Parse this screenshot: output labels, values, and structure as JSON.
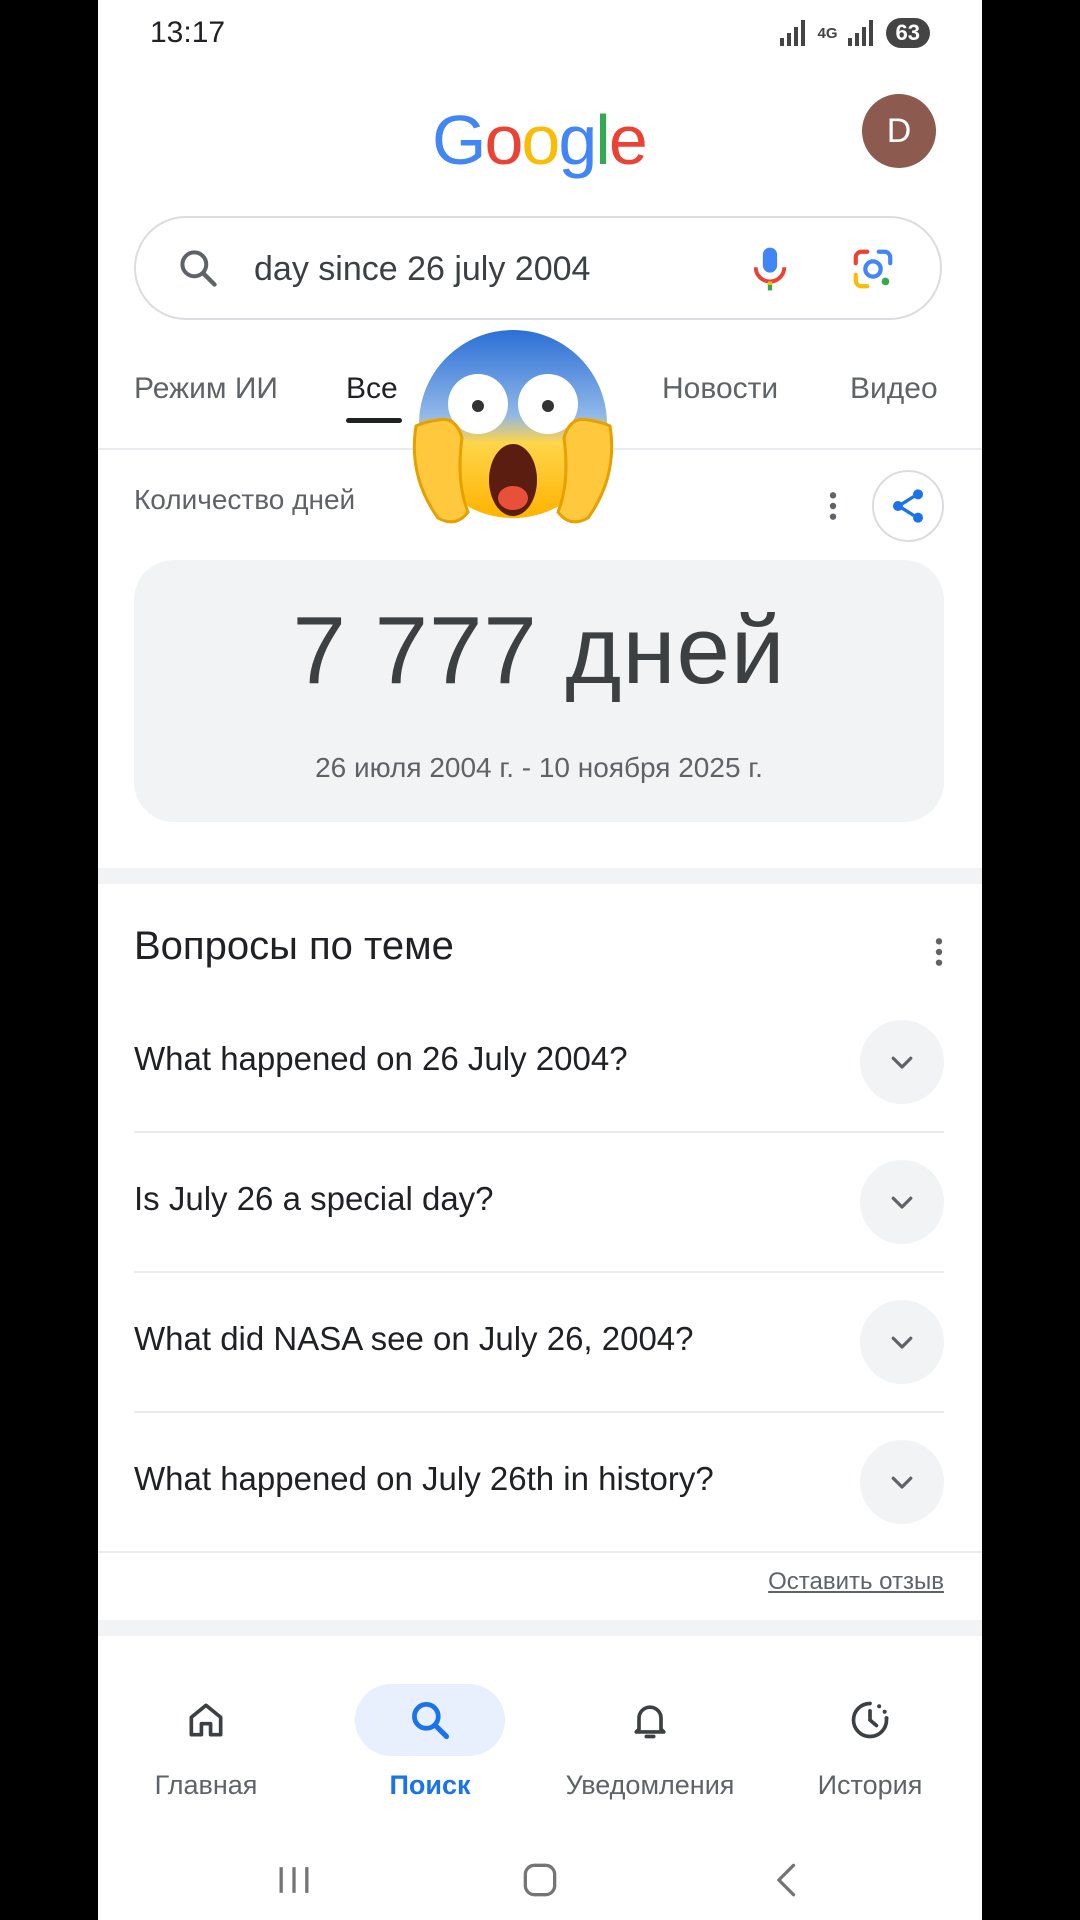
{
  "status_bar": {
    "time": "13:17",
    "network": "4G",
    "battery": "63"
  },
  "header": {
    "logo": [
      "G",
      "o",
      "o",
      "g",
      "l",
      "e"
    ],
    "avatar_letter": "D"
  },
  "search": {
    "query": "day since 26 july 2004"
  },
  "tabs": [
    {
      "label": "Режим ИИ",
      "active": false
    },
    {
      "label": "Все",
      "active": true
    },
    {
      "label": "Новости",
      "active": false
    },
    {
      "label": "Видео",
      "active": false
    }
  ],
  "overlay": {
    "emoji": "face-screaming-in-fear"
  },
  "result": {
    "label": "Количество дней",
    "value": "7 777 дней",
    "range": "26 июля 2004 г. - 10 ноября 2025 г."
  },
  "related": {
    "title": "Вопросы по теме",
    "questions": [
      "What happened on 26 July 2004?",
      "Is July 26 a special day?",
      "What did NASA see on July 26, 2004?",
      "What happened on July 26th in history?"
    ],
    "feedback": "Оставить отзыв"
  },
  "bottom_nav": [
    {
      "label": "Главная",
      "icon": "home-icon",
      "active": false
    },
    {
      "label": "Поиск",
      "icon": "search-icon",
      "active": true
    },
    {
      "label": "Уведомления",
      "icon": "bell-icon",
      "active": false
    },
    {
      "label": "История",
      "icon": "history-icon",
      "active": false
    }
  ],
  "colors": {
    "blue": "#4285F4",
    "red": "#EA4335",
    "yellow": "#FBBC05",
    "green": "#34A853",
    "accent": "#1a73e8"
  }
}
